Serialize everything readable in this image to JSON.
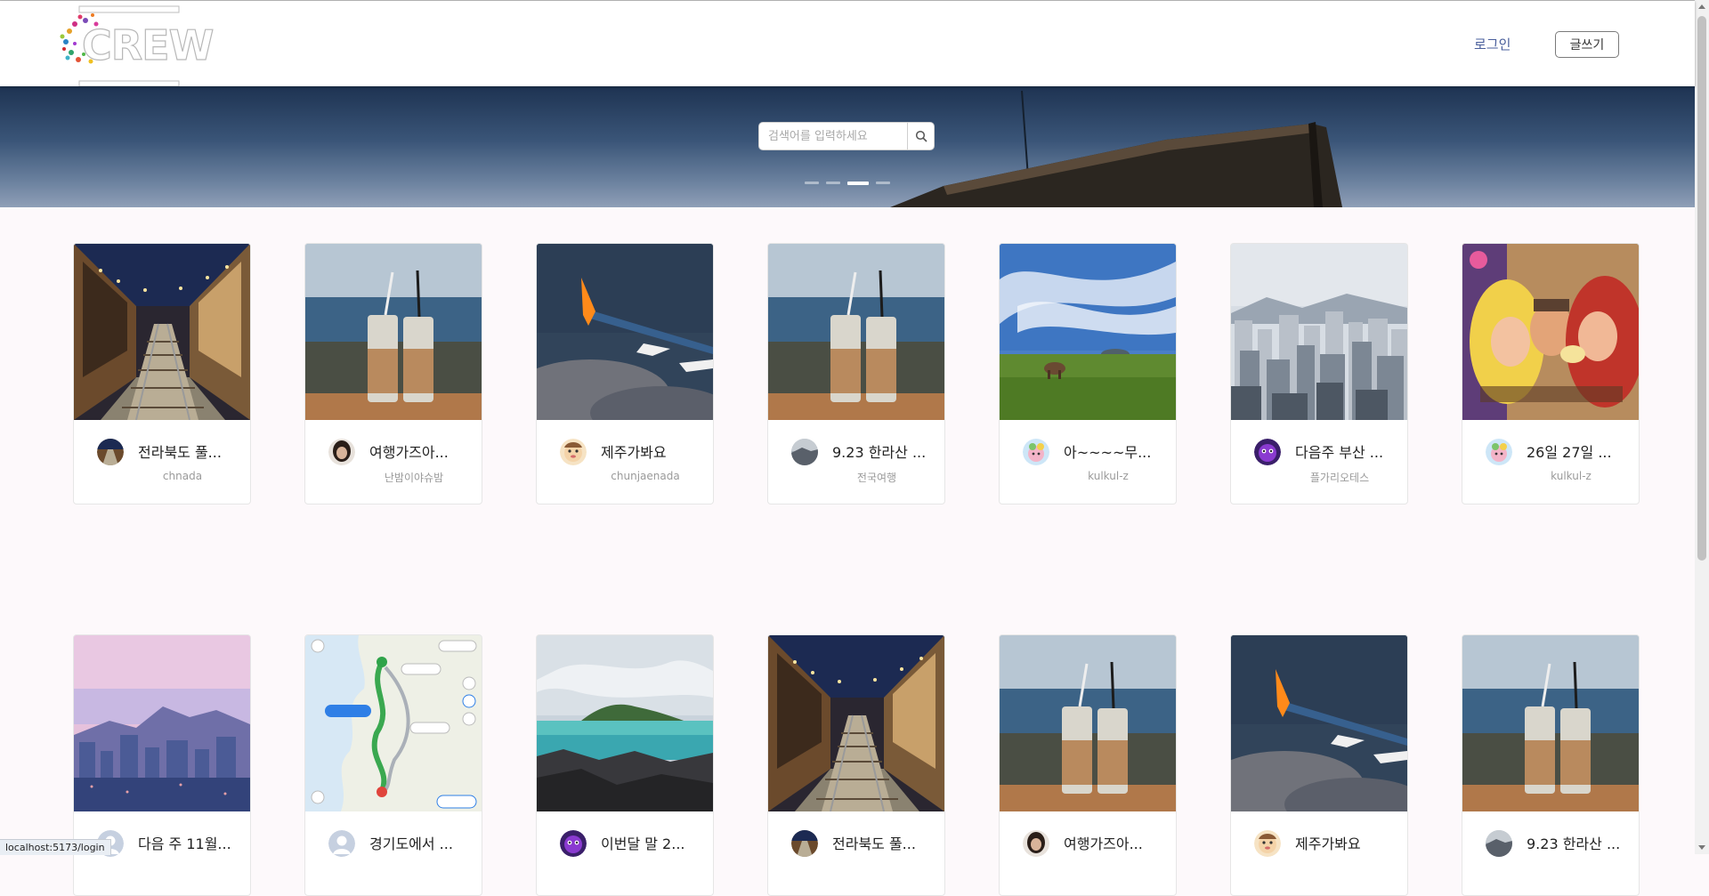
{
  "header": {
    "logo_text": "CREW",
    "login_label": "로그인",
    "write_label": "글쓰기"
  },
  "hero": {
    "search_placeholder": "검색어를 입력하세요",
    "slide_count": 4,
    "active_slide": 3
  },
  "row1": [
    {
      "title": "전라북도 풀...",
      "author": "chnada",
      "thumb": "railway-alley",
      "avatar": "avatar-railway"
    },
    {
      "title": "여행가즈아...",
      "author": "난밤이야슈밤",
      "thumb": "coffee-cups",
      "avatar": "avatar-dark-girl"
    },
    {
      "title": "제주가봐요",
      "author": "chunjaenada",
      "thumb": "airplane-wing",
      "avatar": "avatar-cartoon-face"
    },
    {
      "title": "9.23 한라산 ...",
      "author": "전국여행",
      "thumb": "coffee-cups",
      "avatar": "avatar-grey-landscape"
    },
    {
      "title": "아~~~~무...",
      "author": "kulkul-z",
      "thumb": "green-meadow",
      "avatar": "avatar-colorful-blob"
    },
    {
      "title": "다음주 부산 ...",
      "author": "플가리오테스",
      "thumb": "city-skyline",
      "avatar": "avatar-purple-monster"
    },
    {
      "title": "26일 27일 ...",
      "author": "kulkul-z",
      "thumb": "costume-people",
      "avatar": "avatar-colorful-blob"
    }
  ],
  "row2": [
    {
      "title": "다음 주 11월...",
      "thumb": "pink-skyline",
      "avatar": "avatar-default"
    },
    {
      "title": "경기도에서 ...",
      "thumb": "route-map",
      "avatar": "avatar-default"
    },
    {
      "title": "이번달 말 2...",
      "thumb": "jeju-island",
      "avatar": "avatar-purple-monster"
    },
    {
      "title": "전라북도 풀...",
      "thumb": "railway-alley",
      "avatar": "avatar-railway"
    },
    {
      "title": "여행가즈아...",
      "thumb": "coffee-cups",
      "avatar": "avatar-dark-girl"
    },
    {
      "title": "제주가봐요",
      "thumb": "airplane-wing",
      "avatar": "avatar-cartoon-face"
    },
    {
      "title": "9.23 한라산 ...",
      "thumb": "coffee-cups",
      "avatar": "avatar-grey-landscape"
    }
  ],
  "status_url": "localhost:5173/login"
}
